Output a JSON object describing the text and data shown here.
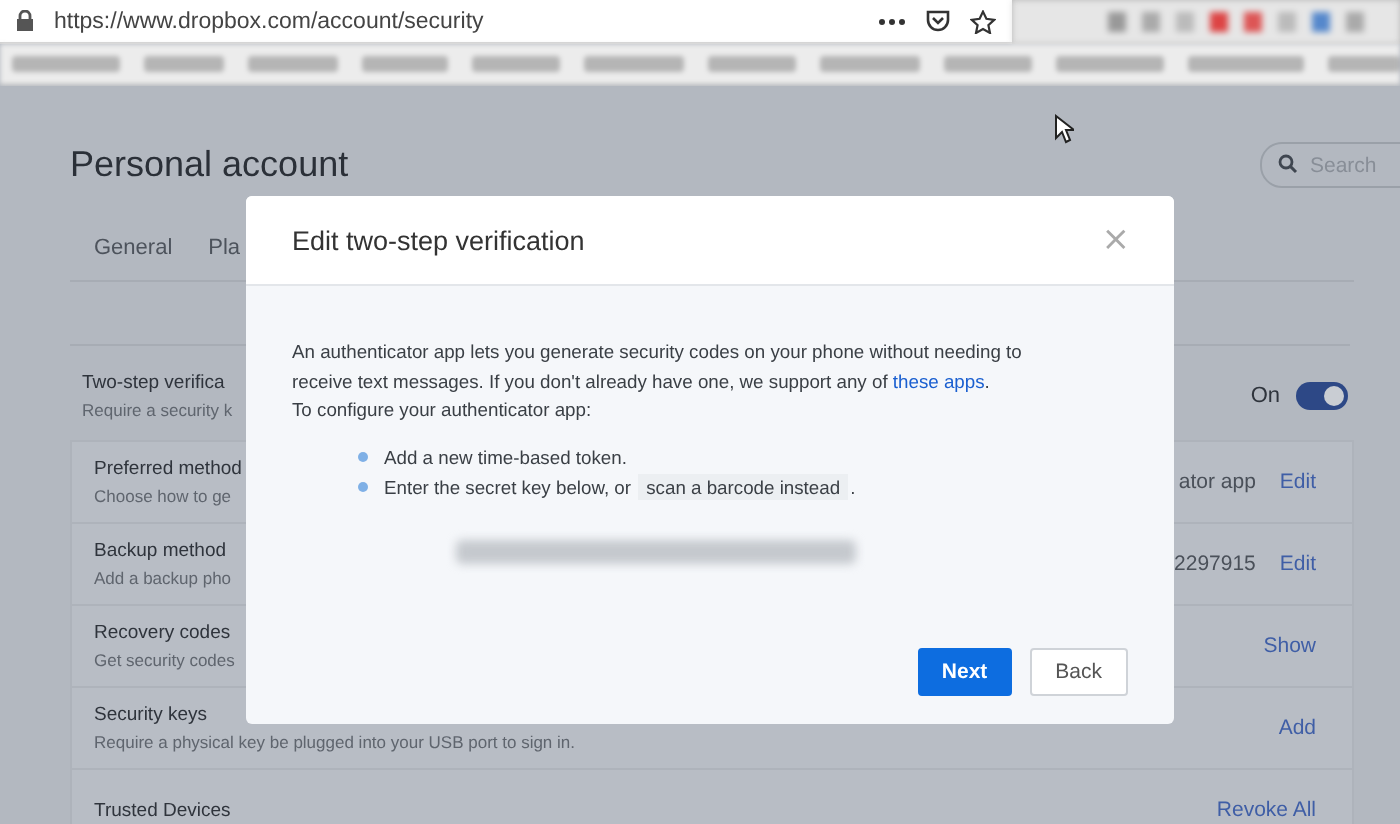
{
  "browser": {
    "url": "https://www.dropbox.com/account/security"
  },
  "page": {
    "title": "Personal account",
    "search": {
      "placeholder": "Search"
    },
    "tabs": [
      {
        "label": "General",
        "selected": false
      },
      {
        "label": "Pla",
        "selected": false
      }
    ],
    "two_step": {
      "title": "Two-step verifica",
      "subtitle": "Require a security k",
      "status": "On",
      "on": true
    },
    "rows": [
      {
        "title": "Preferred method",
        "subtitle": "Choose how to ge",
        "value": "ator app",
        "action": "Edit"
      },
      {
        "title": "Backup method",
        "subtitle": "Add a backup pho",
        "value": "2297915",
        "action": "Edit"
      },
      {
        "title": "Recovery codes",
        "subtitle": "Get security codes",
        "action": "Show"
      },
      {
        "title": "Security keys",
        "subtitle": "Require a physical key be plugged into your USB port to sign in.",
        "action": "Add"
      },
      {
        "title": "Trusted Devices",
        "action": "Revoke All"
      }
    ]
  },
  "modal": {
    "title": "Edit two-step verification",
    "close": "×",
    "intro": "An authenticator app lets you generate security codes on your phone without needing to receive text messages. If you don't already have one, we support any of ",
    "intro_link": "these apps",
    "intro_end": ".",
    "configure": "To configure your authenticator app:",
    "steps": [
      {
        "text": "Add a new time-based token."
      },
      {
        "text": "Enter the secret key below, or ",
        "link": "scan a barcode instead",
        "after": "."
      }
    ],
    "buttons": [
      {
        "label": "Next",
        "kind": "primary"
      },
      {
        "label": "Back",
        "kind": "secondary"
      }
    ]
  }
}
